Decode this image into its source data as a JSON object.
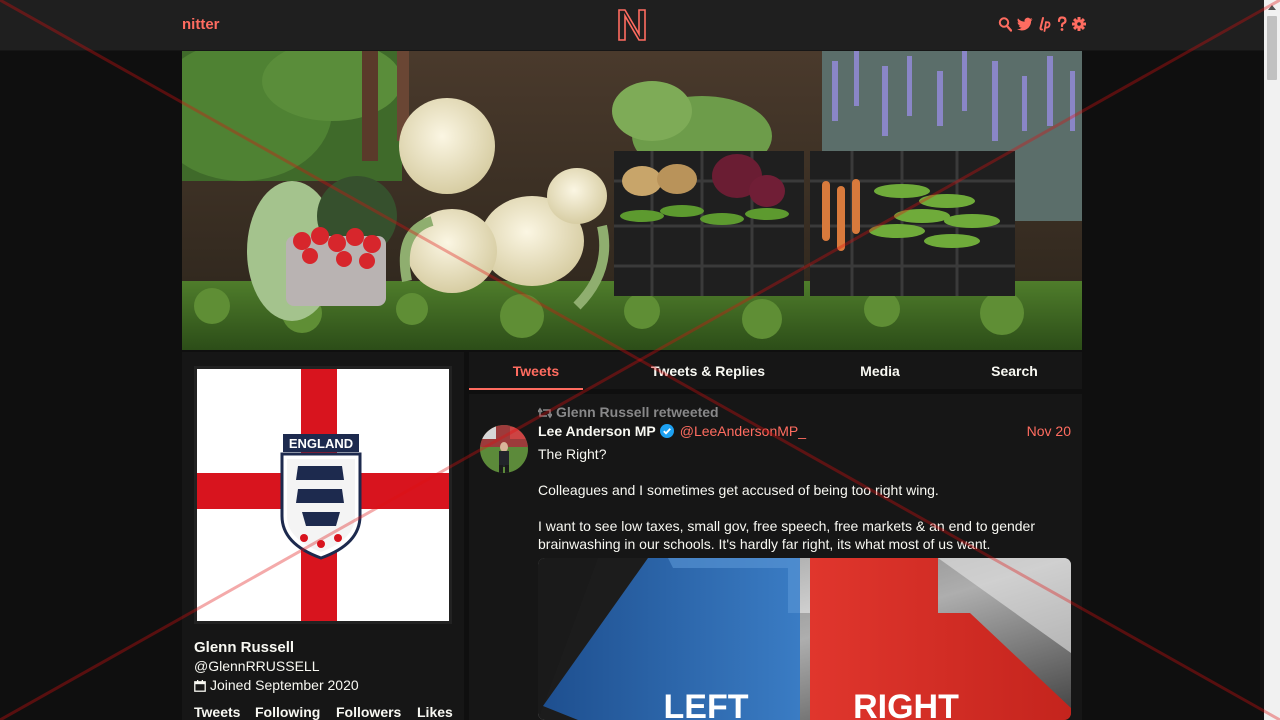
{
  "navbar": {
    "brand": "nitter",
    "logo_letter": "N",
    "icons": [
      "search-icon",
      "twitter-bird-icon",
      "liberapay-icon",
      "help-icon",
      "gear-icon"
    ]
  },
  "colors": {
    "accent": "#ff6c60",
    "background": "#0f0f0f",
    "panel": "#161616",
    "navbar": "#1f1f1f",
    "text": "#f8f8f2",
    "muted": "#888889"
  },
  "profile": {
    "avatar_badge_text": "ENGLAND",
    "fullname": "Glenn Russell",
    "username": "@GlennRRUSSELL",
    "joined": "Joined September 2020",
    "stats": {
      "tweets_label": "Tweets",
      "following_label": "Following",
      "followers_label": "Followers",
      "likes_label": "Likes"
    }
  },
  "tabs": [
    "Tweets",
    "Tweets & Replies",
    "Media",
    "Search"
  ],
  "tweet": {
    "retweet_header": "Glenn Russell retweeted",
    "fullname": "Lee Anderson MP",
    "username": "@LeeAndersonMP_",
    "date": "Nov 20",
    "paragraphs": [
      "The Right?",
      "Colleagues and I sometimes get accused of being too right wing.",
      "I want to see low taxes, small gov, free speech, free markets & an end to gender brainwashing in our schools. It's hardly far right, its what most of us want."
    ],
    "media_labels": {
      "left": "LEFT",
      "right": "RIGHT"
    }
  }
}
